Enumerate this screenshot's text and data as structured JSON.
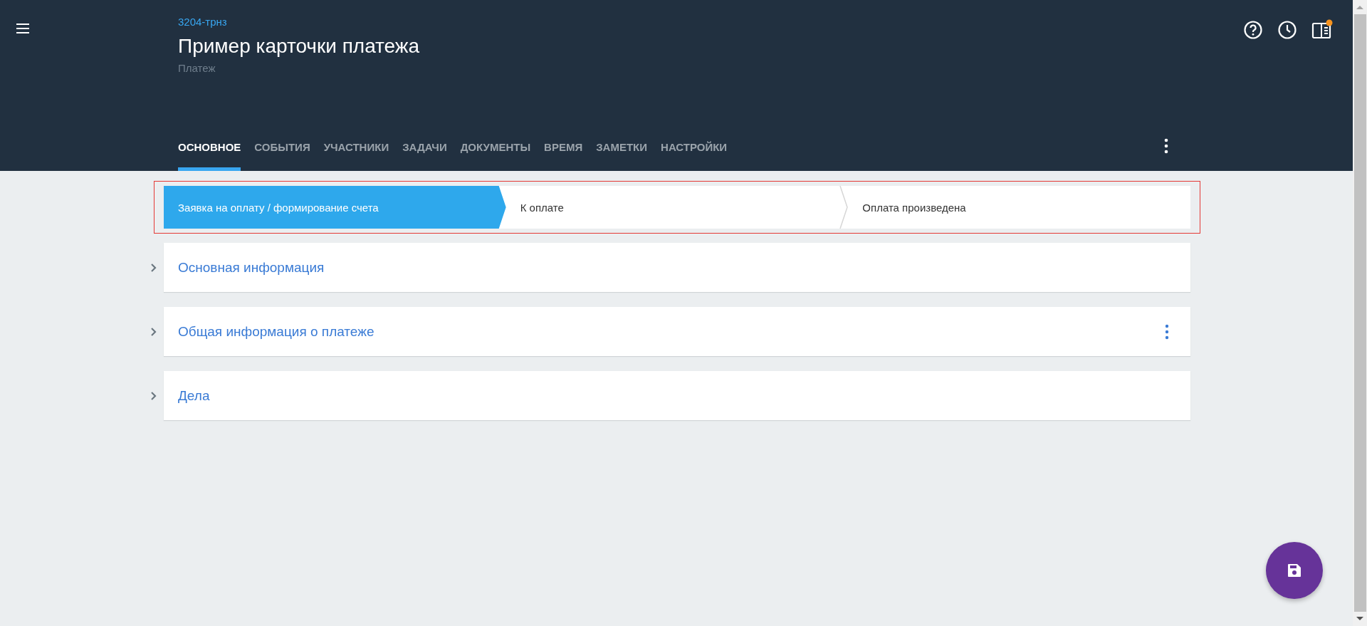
{
  "header": {
    "code": "3204-трнз",
    "title": "Пример карточки платежа",
    "subtitle": "Платеж"
  },
  "tabs": [
    {
      "label": "ОСНОВНОЕ",
      "selected": true
    },
    {
      "label": "СОБЫТИЯ",
      "selected": false
    },
    {
      "label": "УЧАСТНИКИ",
      "selected": false
    },
    {
      "label": "ЗАДАЧИ",
      "selected": false
    },
    {
      "label": "ДОКУМЕНТЫ",
      "selected": false
    },
    {
      "label": "ВРЕМЯ",
      "selected": false
    },
    {
      "label": "ЗАМЕТКИ",
      "selected": false
    },
    {
      "label": "НАСТРОЙКИ",
      "selected": false
    }
  ],
  "stages": [
    {
      "label": "Заявка на оплату / формирование счета",
      "selected": true
    },
    {
      "label": "К оплате",
      "selected": false
    },
    {
      "label": "Оплата произведена",
      "selected": false
    }
  ],
  "sections": [
    {
      "title": "Основная информация",
      "expanded": false,
      "menu": false
    },
    {
      "title": "Общая информация о платеже",
      "expanded": false,
      "menu": true
    },
    {
      "title": "Дела",
      "expanded": false,
      "menu": false
    }
  ]
}
